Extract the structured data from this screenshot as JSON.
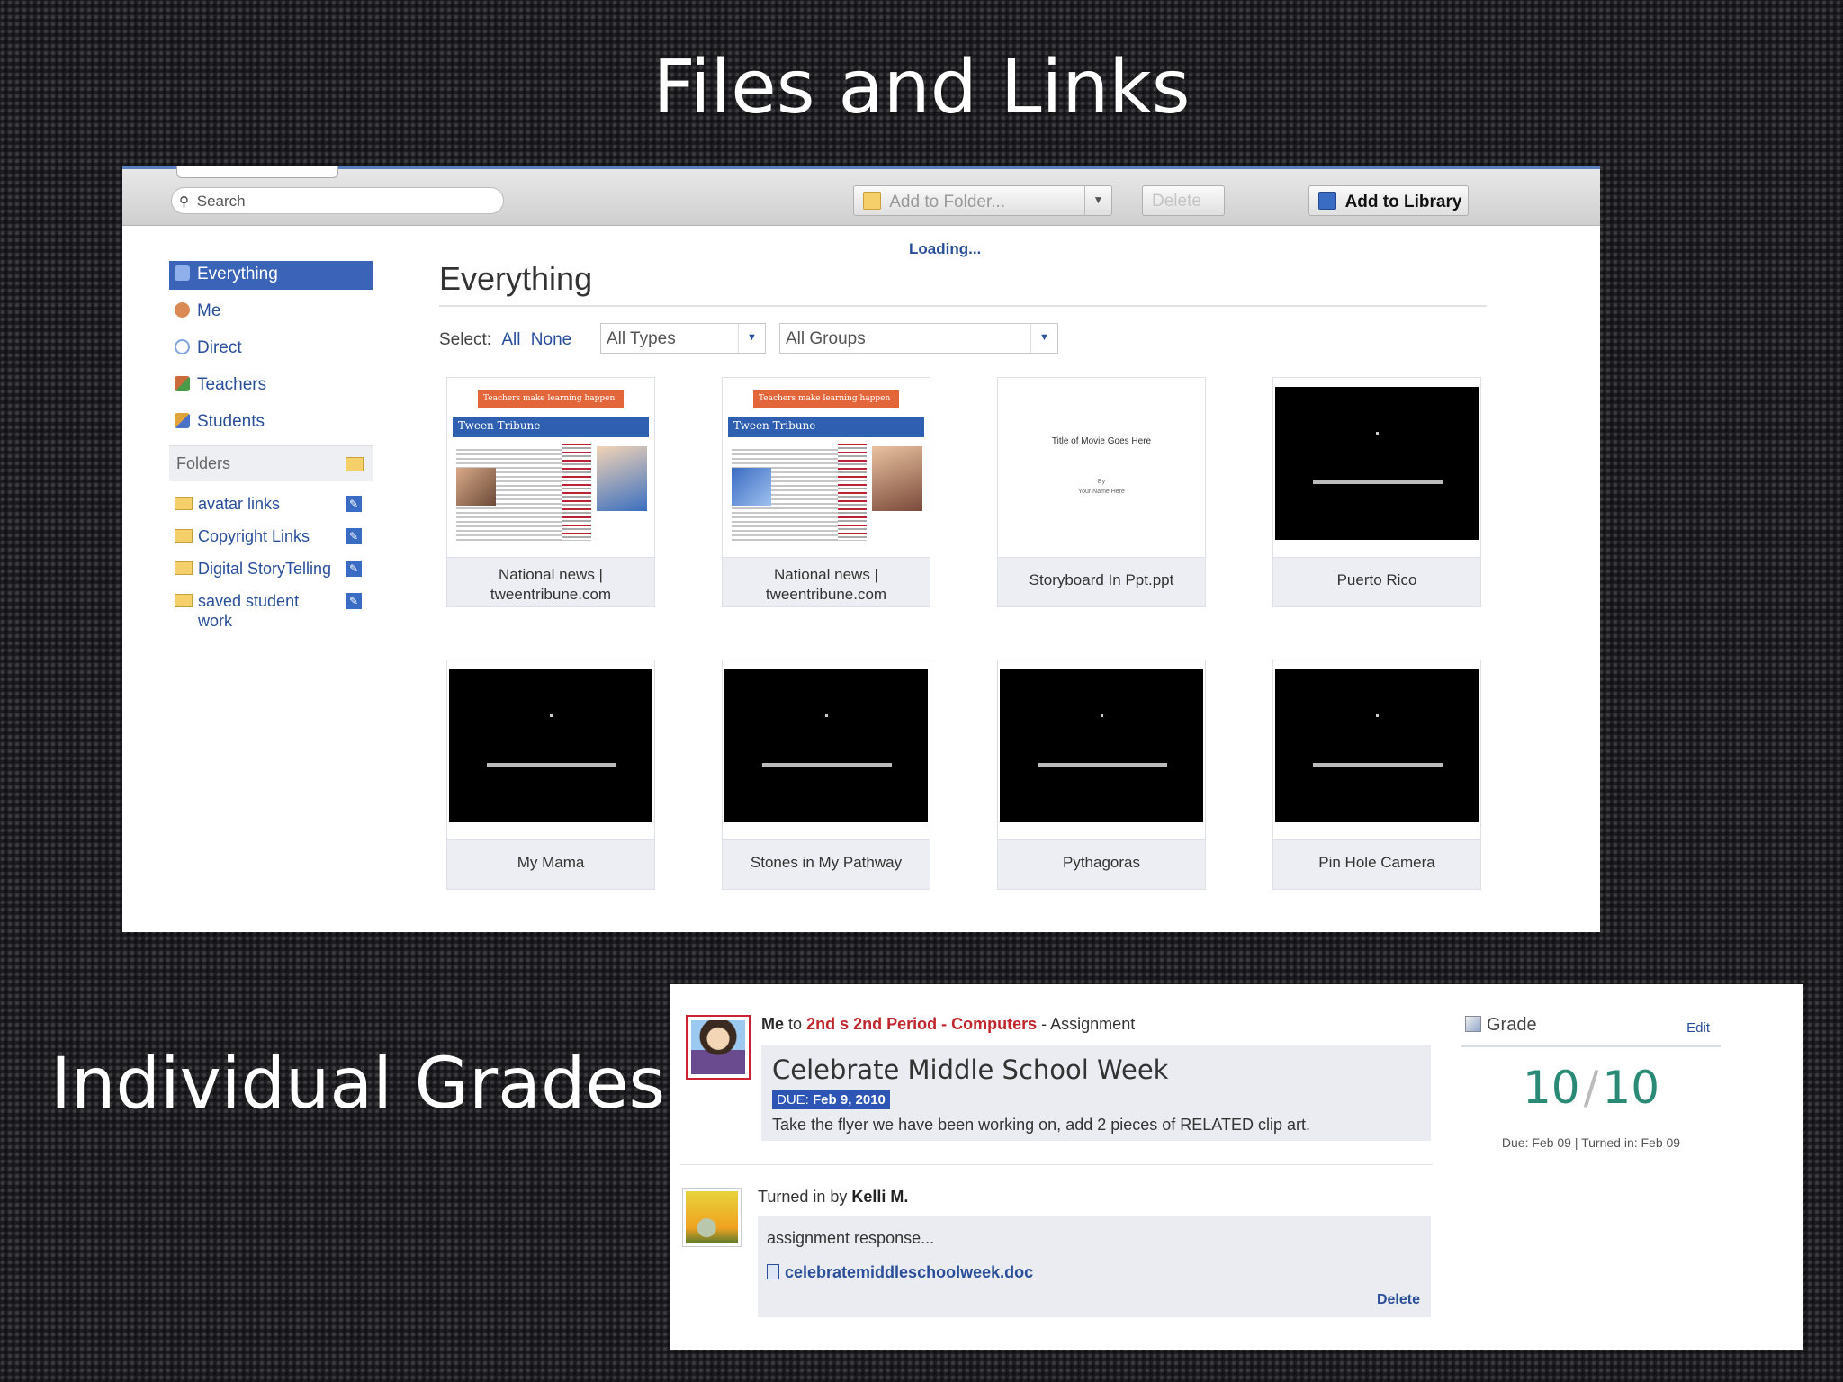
{
  "slide": {
    "title": "Files and Links",
    "section_label": "Individual Grades"
  },
  "toolbar": {
    "search_placeholder": "Search",
    "add_to_folder": "Add to Folder...",
    "delete": "Delete",
    "add_to_library": "Add to Library"
  },
  "sidebar": {
    "items": [
      {
        "label": "Everything",
        "icon": "everything-icon",
        "color": "#5a7fc9"
      },
      {
        "label": "Me",
        "icon": "user-icon",
        "color": "#d98a55"
      },
      {
        "label": "Direct",
        "icon": "speech-bubble-icon",
        "color": "#7fa3dd"
      },
      {
        "label": "Teachers",
        "icon": "teachers-icon",
        "color": "#c96b3a"
      },
      {
        "label": "Students",
        "icon": "students-icon",
        "color": "#e0a43a"
      }
    ],
    "folders_header": "Folders",
    "folders": [
      {
        "label": "avatar links"
      },
      {
        "label": "Copyright Links"
      },
      {
        "label": "Digital StoryTelling"
      },
      {
        "label": "saved student work"
      }
    ]
  },
  "content": {
    "loading": "Loading...",
    "title": "Everything",
    "select_label": "Select:",
    "select_all": "All",
    "select_none": "None",
    "types_filter": "All Types",
    "groups_filter": "All Groups",
    "items": [
      {
        "label": "National news | tweentribune.com",
        "kind": "newspaper",
        "banner": "Teachers make learning happen",
        "masthead": "Tween Tribune"
      },
      {
        "label": "National news | tweentribune.com",
        "kind": "newspaper",
        "banner": "Teachers make learning happen",
        "masthead": "Tween Tribune"
      },
      {
        "label": "Storyboard In Ppt.ppt",
        "kind": "document",
        "doc_title": "Title of Movie Goes Here",
        "doc_by": "By",
        "doc_name": "Your Name Here"
      },
      {
        "label": "Puerto Rico",
        "kind": "video"
      },
      {
        "label": "My Mama",
        "kind": "video"
      },
      {
        "label": "Stones in My Pathway",
        "kind": "video"
      },
      {
        "label": "Pythagoras",
        "kind": "video"
      },
      {
        "label": "Pin Hole Camera",
        "kind": "video"
      }
    ]
  },
  "assignment": {
    "sender": "Me",
    "to": "to",
    "group": "2nd s 2nd Period",
    "sep": "-",
    "course": "Computers",
    "type": "- Assignment",
    "title": "Celebrate Middle School Week",
    "due_label": "DUE:",
    "due_date": "Feb 9, 2010",
    "description": "Take the flyer we have been working on, add 2 pieces of RELATED clip art.",
    "turned_in_prefix": "Turned in by",
    "turned_in_by": "Kelli M.",
    "response": "assignment response...",
    "attachment": "celebratemiddleschoolweek.doc",
    "delete": "Delete"
  },
  "grade": {
    "header": "Grade",
    "edit": "Edit",
    "score": "10",
    "max": "10",
    "dates": "Due: Feb 09 | Turned in: Feb 09"
  },
  "colors": {
    "accent": "#2a4f9a",
    "active_nav": "#3b63b7",
    "group_link": "#c0262c",
    "grade_score": "#2a8a76"
  }
}
